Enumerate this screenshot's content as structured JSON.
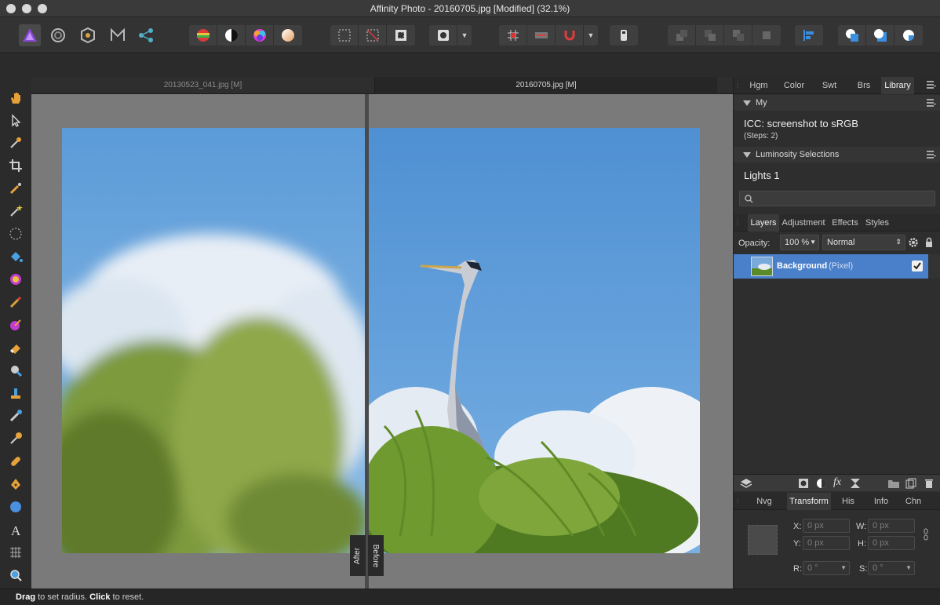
{
  "window": {
    "title": "Affinity Photo - 20160705.jpg [Modified] (32.1%)"
  },
  "document_tabs": [
    {
      "label": "20130523_041.jpg [M]"
    },
    {
      "label": "20160705.jpg [M]"
    }
  ],
  "canvas": {
    "after_label": "After",
    "before_label": "Before"
  },
  "top_panel": {
    "tabs": [
      "Hgm",
      "Color",
      "Swt",
      "Brs",
      "Library"
    ],
    "active_tab": "Library",
    "section1": {
      "title": "My"
    },
    "macro": {
      "name": "ICC: screenshot to sRGB",
      "steps": "(Steps: 2)"
    },
    "section2": {
      "title": "Luminosity Selections"
    },
    "entry": "Lights 1"
  },
  "layers_panel": {
    "tabs": [
      "Layers",
      "Adjustment",
      "Effects",
      "Styles"
    ],
    "active_tab": "Layers",
    "opacity_label": "Opacity:",
    "opacity_value": "100 %",
    "blend_mode": "Normal",
    "layers": [
      {
        "name": "Background",
        "kind": "(Pixel)",
        "visible": true
      }
    ]
  },
  "transform_panel": {
    "tabs": [
      "Nvg",
      "Transform",
      "His",
      "Info",
      "Chn"
    ],
    "active_tab": "Transform",
    "x_label": "X:",
    "x_value": "0 px",
    "y_label": "Y:",
    "y_value": "0 px",
    "w_label": "W:",
    "w_value": "0 px",
    "h_label": "H:",
    "h_value": "0 px",
    "r_label": "R:",
    "r_value": "0 °",
    "s_label": "S:",
    "s_value": "0 °"
  },
  "statusbar": {
    "drag": "Drag",
    "drag_text": " to set radius. ",
    "click": "Click",
    "click_text": " to reset."
  },
  "colors": {
    "selection": "#4a7fc9",
    "accent_persona": "#7b3fb5"
  }
}
